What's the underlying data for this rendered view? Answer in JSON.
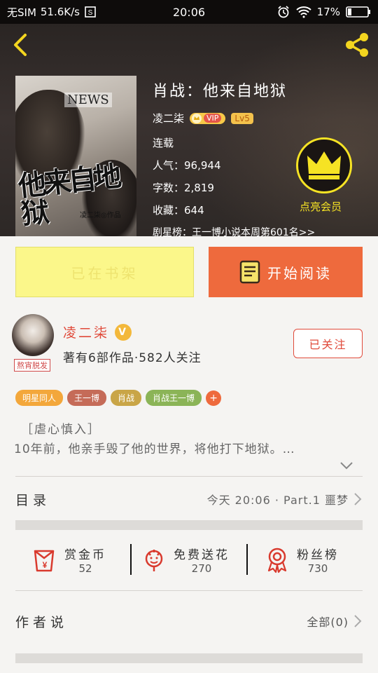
{
  "status_bar": {
    "carrier": "无SIM",
    "speed": "51.6K/s",
    "time": "20:06",
    "battery": "17%",
    "icons": [
      "screenshot-icon",
      "alarm-icon",
      "wifi-icon",
      "battery-icon"
    ]
  },
  "header": {
    "book_title": "肖战：他来自地狱",
    "author": "凌二柒",
    "vip_label": "VIP",
    "level": "Lv5",
    "status": "连载",
    "popularity": "人气：96,944",
    "word_count": "字数：2,819",
    "favorites": "收藏：644",
    "ranking": "剧星榜：王一博小说本周第601名>>",
    "member_label": "点亮会员",
    "cover": {
      "news": "NEWS",
      "title": "他来自地狱",
      "author": "凌二柒◎作品"
    }
  },
  "actions": {
    "shelf_label": "已在书架",
    "read_label": "开始阅读"
  },
  "author_block": {
    "name": "凌二柒",
    "v_badge": "V",
    "stats": "著有6部作品·582人关注",
    "avatar_tag": "熬宵脱发",
    "follow_label": "已关注"
  },
  "tags": [
    {
      "label": "明星同人",
      "color": "#f3a73b"
    },
    {
      "label": "王一博",
      "color": "#c56b58"
    },
    {
      "label": "肖战",
      "color": "#c9a547"
    },
    {
      "label": "肖战王一博",
      "color": "#8bb457"
    }
  ],
  "tag_more": "+",
  "intro": {
    "tag": "［虐心慎入］",
    "text": "10年前，他亲手毁了他的世界，将他打下地狱。…"
  },
  "catalog": {
    "label": "目录",
    "latest": "今天 20:06 · Part.1 噩梦"
  },
  "stats": [
    {
      "label": "赏金币",
      "value": "52",
      "icon": "red-envelope-icon"
    },
    {
      "label": "免费送花",
      "value": "270",
      "icon": "flower-icon"
    },
    {
      "label": "粉丝榜",
      "value": "730",
      "icon": "medal-icon"
    }
  ],
  "author_says": {
    "label": "作者说",
    "all": "全部(0)"
  },
  "colors": {
    "accent_orange": "#ee6a3d",
    "accent_red": "#e04a3a",
    "crown_yellow": "#f6e324",
    "shelf_yellow": "#fbf78a"
  }
}
